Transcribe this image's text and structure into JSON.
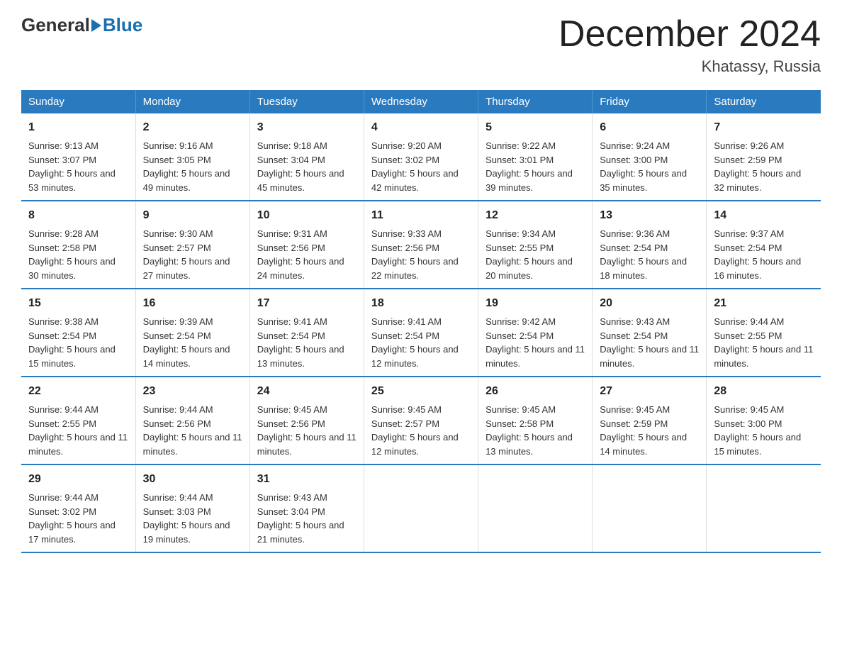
{
  "logo": {
    "general": "General",
    "arrow": "▶",
    "blue": "Blue"
  },
  "title": "December 2024",
  "subtitle": "Khatassy, Russia",
  "days_header": [
    "Sunday",
    "Monday",
    "Tuesday",
    "Wednesday",
    "Thursday",
    "Friday",
    "Saturday"
  ],
  "weeks": [
    [
      {
        "day": "1",
        "sunrise": "Sunrise: 9:13 AM",
        "sunset": "Sunset: 3:07 PM",
        "daylight": "Daylight: 5 hours and 53 minutes."
      },
      {
        "day": "2",
        "sunrise": "Sunrise: 9:16 AM",
        "sunset": "Sunset: 3:05 PM",
        "daylight": "Daylight: 5 hours and 49 minutes."
      },
      {
        "day": "3",
        "sunrise": "Sunrise: 9:18 AM",
        "sunset": "Sunset: 3:04 PM",
        "daylight": "Daylight: 5 hours and 45 minutes."
      },
      {
        "day": "4",
        "sunrise": "Sunrise: 9:20 AM",
        "sunset": "Sunset: 3:02 PM",
        "daylight": "Daylight: 5 hours and 42 minutes."
      },
      {
        "day": "5",
        "sunrise": "Sunrise: 9:22 AM",
        "sunset": "Sunset: 3:01 PM",
        "daylight": "Daylight: 5 hours and 39 minutes."
      },
      {
        "day": "6",
        "sunrise": "Sunrise: 9:24 AM",
        "sunset": "Sunset: 3:00 PM",
        "daylight": "Daylight: 5 hours and 35 minutes."
      },
      {
        "day": "7",
        "sunrise": "Sunrise: 9:26 AM",
        "sunset": "Sunset: 2:59 PM",
        "daylight": "Daylight: 5 hours and 32 minutes."
      }
    ],
    [
      {
        "day": "8",
        "sunrise": "Sunrise: 9:28 AM",
        "sunset": "Sunset: 2:58 PM",
        "daylight": "Daylight: 5 hours and 30 minutes."
      },
      {
        "day": "9",
        "sunrise": "Sunrise: 9:30 AM",
        "sunset": "Sunset: 2:57 PM",
        "daylight": "Daylight: 5 hours and 27 minutes."
      },
      {
        "day": "10",
        "sunrise": "Sunrise: 9:31 AM",
        "sunset": "Sunset: 2:56 PM",
        "daylight": "Daylight: 5 hours and 24 minutes."
      },
      {
        "day": "11",
        "sunrise": "Sunrise: 9:33 AM",
        "sunset": "Sunset: 2:56 PM",
        "daylight": "Daylight: 5 hours and 22 minutes."
      },
      {
        "day": "12",
        "sunrise": "Sunrise: 9:34 AM",
        "sunset": "Sunset: 2:55 PM",
        "daylight": "Daylight: 5 hours and 20 minutes."
      },
      {
        "day": "13",
        "sunrise": "Sunrise: 9:36 AM",
        "sunset": "Sunset: 2:54 PM",
        "daylight": "Daylight: 5 hours and 18 minutes."
      },
      {
        "day": "14",
        "sunrise": "Sunrise: 9:37 AM",
        "sunset": "Sunset: 2:54 PM",
        "daylight": "Daylight: 5 hours and 16 minutes."
      }
    ],
    [
      {
        "day": "15",
        "sunrise": "Sunrise: 9:38 AM",
        "sunset": "Sunset: 2:54 PM",
        "daylight": "Daylight: 5 hours and 15 minutes."
      },
      {
        "day": "16",
        "sunrise": "Sunrise: 9:39 AM",
        "sunset": "Sunset: 2:54 PM",
        "daylight": "Daylight: 5 hours and 14 minutes."
      },
      {
        "day": "17",
        "sunrise": "Sunrise: 9:41 AM",
        "sunset": "Sunset: 2:54 PM",
        "daylight": "Daylight: 5 hours and 13 minutes."
      },
      {
        "day": "18",
        "sunrise": "Sunrise: 9:41 AM",
        "sunset": "Sunset: 2:54 PM",
        "daylight": "Daylight: 5 hours and 12 minutes."
      },
      {
        "day": "19",
        "sunrise": "Sunrise: 9:42 AM",
        "sunset": "Sunset: 2:54 PM",
        "daylight": "Daylight: 5 hours and 11 minutes."
      },
      {
        "day": "20",
        "sunrise": "Sunrise: 9:43 AM",
        "sunset": "Sunset: 2:54 PM",
        "daylight": "Daylight: 5 hours and 11 minutes."
      },
      {
        "day": "21",
        "sunrise": "Sunrise: 9:44 AM",
        "sunset": "Sunset: 2:55 PM",
        "daylight": "Daylight: 5 hours and 11 minutes."
      }
    ],
    [
      {
        "day": "22",
        "sunrise": "Sunrise: 9:44 AM",
        "sunset": "Sunset: 2:55 PM",
        "daylight": "Daylight: 5 hours and 11 minutes."
      },
      {
        "day": "23",
        "sunrise": "Sunrise: 9:44 AM",
        "sunset": "Sunset: 2:56 PM",
        "daylight": "Daylight: 5 hours and 11 minutes."
      },
      {
        "day": "24",
        "sunrise": "Sunrise: 9:45 AM",
        "sunset": "Sunset: 2:56 PM",
        "daylight": "Daylight: 5 hours and 11 minutes."
      },
      {
        "day": "25",
        "sunrise": "Sunrise: 9:45 AM",
        "sunset": "Sunset: 2:57 PM",
        "daylight": "Daylight: 5 hours and 12 minutes."
      },
      {
        "day": "26",
        "sunrise": "Sunrise: 9:45 AM",
        "sunset": "Sunset: 2:58 PM",
        "daylight": "Daylight: 5 hours and 13 minutes."
      },
      {
        "day": "27",
        "sunrise": "Sunrise: 9:45 AM",
        "sunset": "Sunset: 2:59 PM",
        "daylight": "Daylight: 5 hours and 14 minutes."
      },
      {
        "day": "28",
        "sunrise": "Sunrise: 9:45 AM",
        "sunset": "Sunset: 3:00 PM",
        "daylight": "Daylight: 5 hours and 15 minutes."
      }
    ],
    [
      {
        "day": "29",
        "sunrise": "Sunrise: 9:44 AM",
        "sunset": "Sunset: 3:02 PM",
        "daylight": "Daylight: 5 hours and 17 minutes."
      },
      {
        "day": "30",
        "sunrise": "Sunrise: 9:44 AM",
        "sunset": "Sunset: 3:03 PM",
        "daylight": "Daylight: 5 hours and 19 minutes."
      },
      {
        "day": "31",
        "sunrise": "Sunrise: 9:43 AM",
        "sunset": "Sunset: 3:04 PM",
        "daylight": "Daylight: 5 hours and 21 minutes."
      },
      null,
      null,
      null,
      null
    ]
  ]
}
